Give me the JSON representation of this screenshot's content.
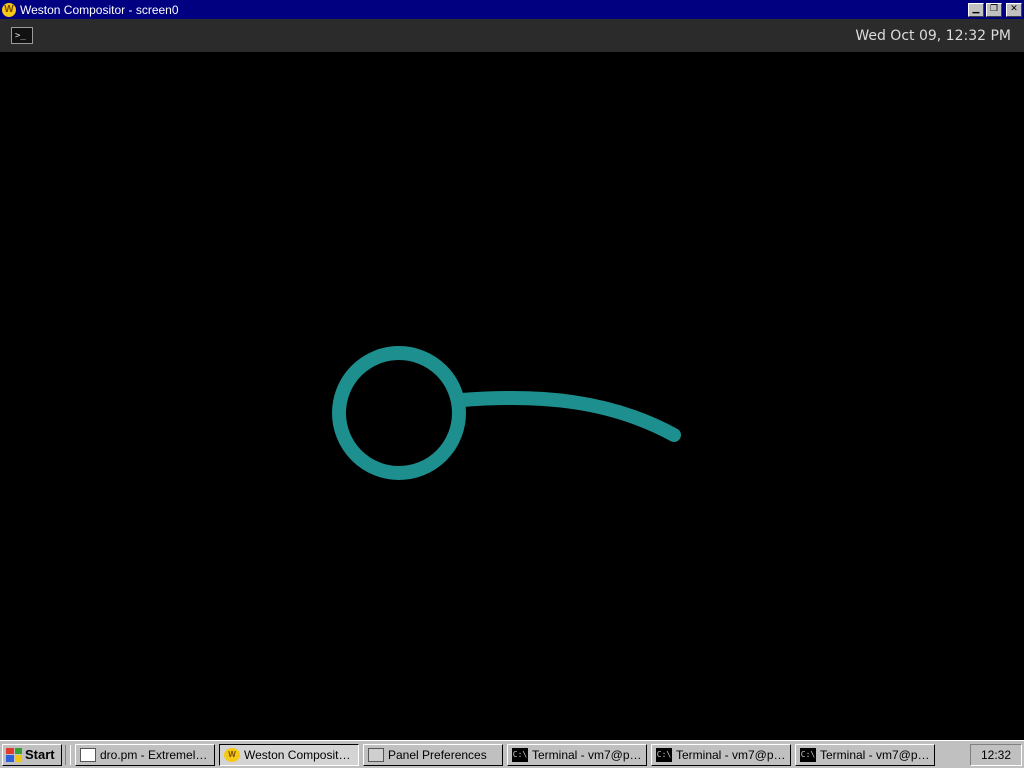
{
  "window": {
    "title": "Weston Compositor - screen0",
    "app_icon_glyph": "W",
    "buttons": [
      "minimize",
      "maximize",
      "close"
    ]
  },
  "panel": {
    "clock": "Wed Oct 09, 12:32 PM",
    "launcher_icon": "terminal-icon"
  },
  "canvas": {
    "stroke_color": "#1e8f8f",
    "background": "#000000"
  },
  "taskbar": {
    "start_label": "Start",
    "tasks": [
      {
        "label": "dro.pm - Extremely ...",
        "icon": "document-icon",
        "active": false
      },
      {
        "label": "Weston Compositor...",
        "icon": "weston-icon",
        "active": true
      },
      {
        "label": "Panel Preferences",
        "icon": "preferences-icon",
        "active": false
      },
      {
        "label": "Terminal - vm7@pa...",
        "icon": "terminal-icon",
        "active": false
      },
      {
        "label": "Terminal - vm7@pa...",
        "icon": "terminal-icon",
        "active": false
      },
      {
        "label": "Terminal - vm7@pa...",
        "icon": "terminal-icon",
        "active": false
      }
    ],
    "tray_clock": "12:32"
  }
}
